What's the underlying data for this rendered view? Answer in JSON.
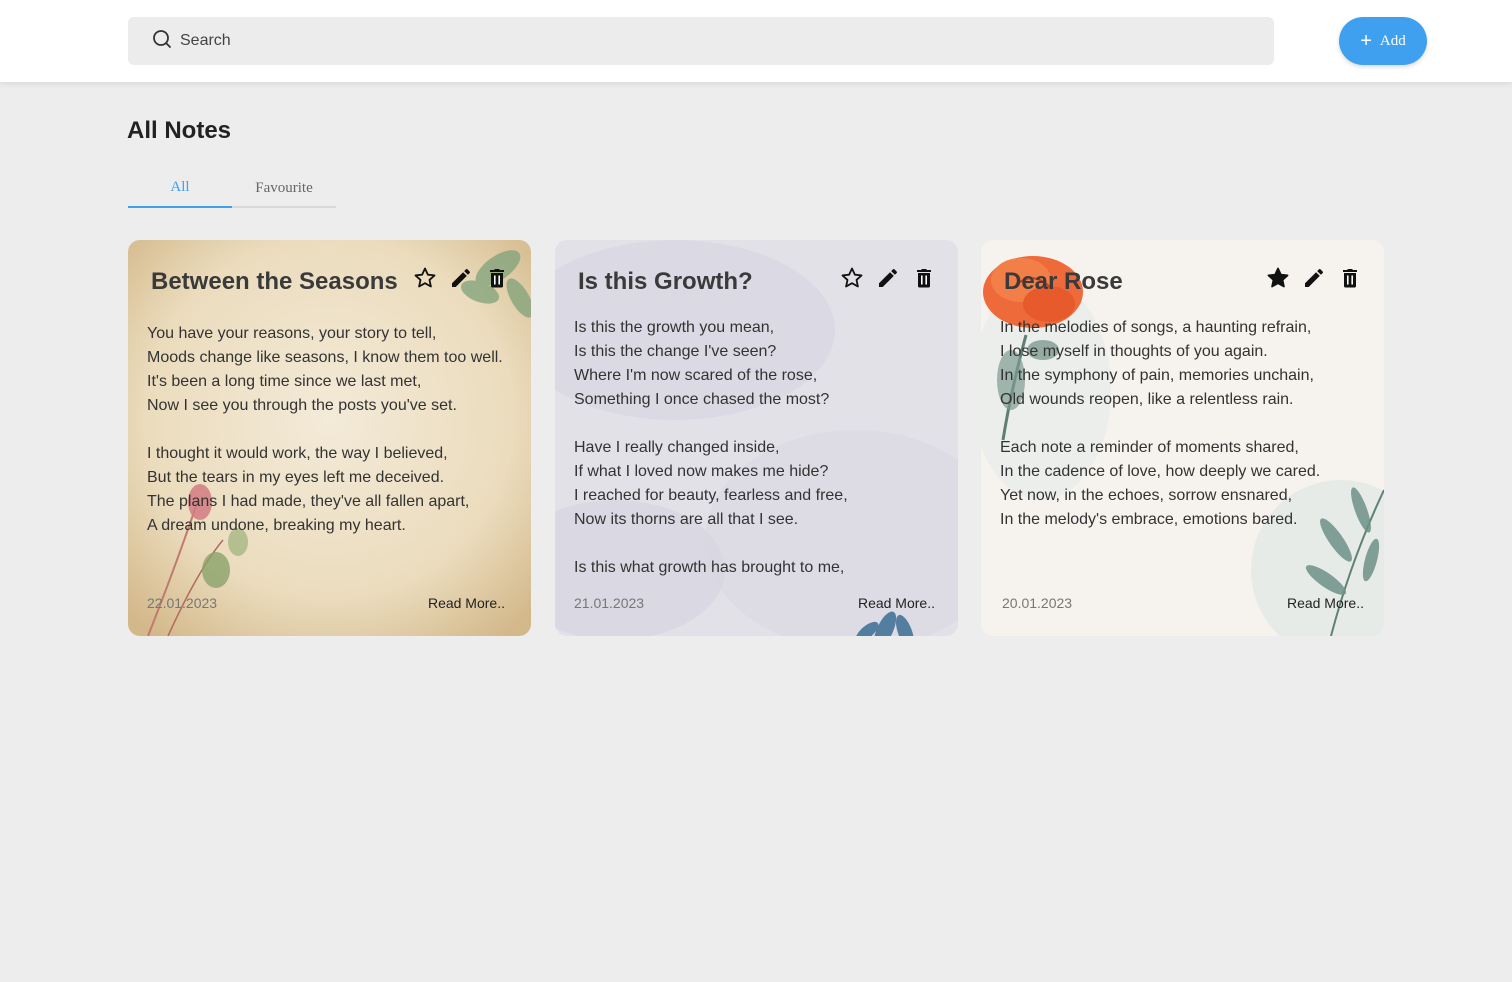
{
  "search": {
    "placeholder": "Search",
    "icon": "search-icon"
  },
  "add_button": {
    "label": "Add",
    "color": "#3ea0ee"
  },
  "page_title": "All Notes",
  "tabs": [
    {
      "label": "All",
      "active": true
    },
    {
      "label": "Favourite",
      "active": false
    }
  ],
  "notes": [
    {
      "title": "Between the Seasons",
      "favourite": false,
      "date": "22.01.2023",
      "read_more": "Read More..",
      "lines": [
        "You have your reasons, your story to tell,",
        "Moods change like seasons, I know them too well.",
        "It's been a long time since we last met,",
        "Now I see you through the posts you've set.",
        "",
        "I thought it would work, the way I believed,",
        "But the tears in my eyes left me deceived.",
        "The plans I had made, they've all fallen apart,",
        "A dream undone, breaking my heart."
      ]
    },
    {
      "title": "Is this Growth?",
      "favourite": false,
      "date": "21.01.2023",
      "read_more": "Read More..",
      "lines": [
        "Is this the growth you mean,",
        "Is this the change I've seen?",
        "Where I'm now scared of the rose,",
        "Something I once chased the most?",
        "",
        "Have I really changed inside,",
        "If what I loved now makes me hide?",
        "I reached for beauty, fearless and free,",
        "Now its thorns are all that I see.",
        "",
        "Is this what growth has brought to me,"
      ]
    },
    {
      "title": "Dear Rose",
      "favourite": true,
      "date": "20.01.2023",
      "read_more": "Read More..",
      "lines": [
        "In the melodies of songs, a haunting refrain,",
        "I lose myself in thoughts of you again.",
        "In the symphony of pain, memories unchain,",
        "Old wounds reopen, like a relentless rain.",
        "",
        "Each note a reminder of moments shared,",
        "In the cadence of love, how deeply we cared.",
        "Yet now, in the echoes, sorrow ensnared,",
        "In the melody's embrace, emotions bared."
      ]
    }
  ]
}
